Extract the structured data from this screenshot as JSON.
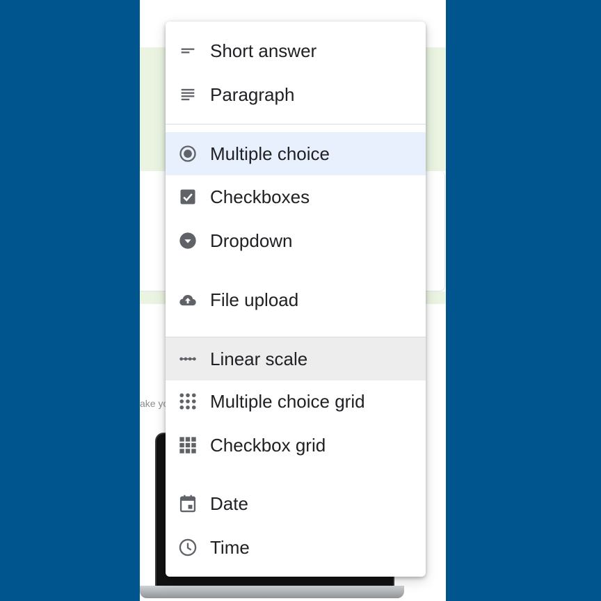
{
  "background_snippet": "ake yo",
  "menu": {
    "items": [
      {
        "label": "Short answer",
        "icon": "short-answer-icon"
      },
      {
        "label": "Paragraph",
        "icon": "paragraph-icon"
      },
      {
        "label": "Multiple choice",
        "icon": "radio-button-icon",
        "state": "selected"
      },
      {
        "label": "Checkboxes",
        "icon": "checkbox-icon"
      },
      {
        "label": "Dropdown",
        "icon": "dropdown-icon"
      },
      {
        "label": "File upload",
        "icon": "cloud-upload-icon"
      },
      {
        "label": "Linear scale",
        "icon": "linear-scale-icon",
        "state": "hovered"
      },
      {
        "label": "Multiple choice grid",
        "icon": "dot-grid-icon"
      },
      {
        "label": "Checkbox grid",
        "icon": "square-grid-icon"
      },
      {
        "label": "Date",
        "icon": "calendar-icon"
      },
      {
        "label": "Time",
        "icon": "clock-icon"
      }
    ]
  },
  "colors": {
    "background": "#01558f",
    "icon": "#5f6368",
    "text": "#202124",
    "selected_bg": "#e8f0fe",
    "hover_bg": "#ededed",
    "form_band": "#eaf4e1"
  }
}
